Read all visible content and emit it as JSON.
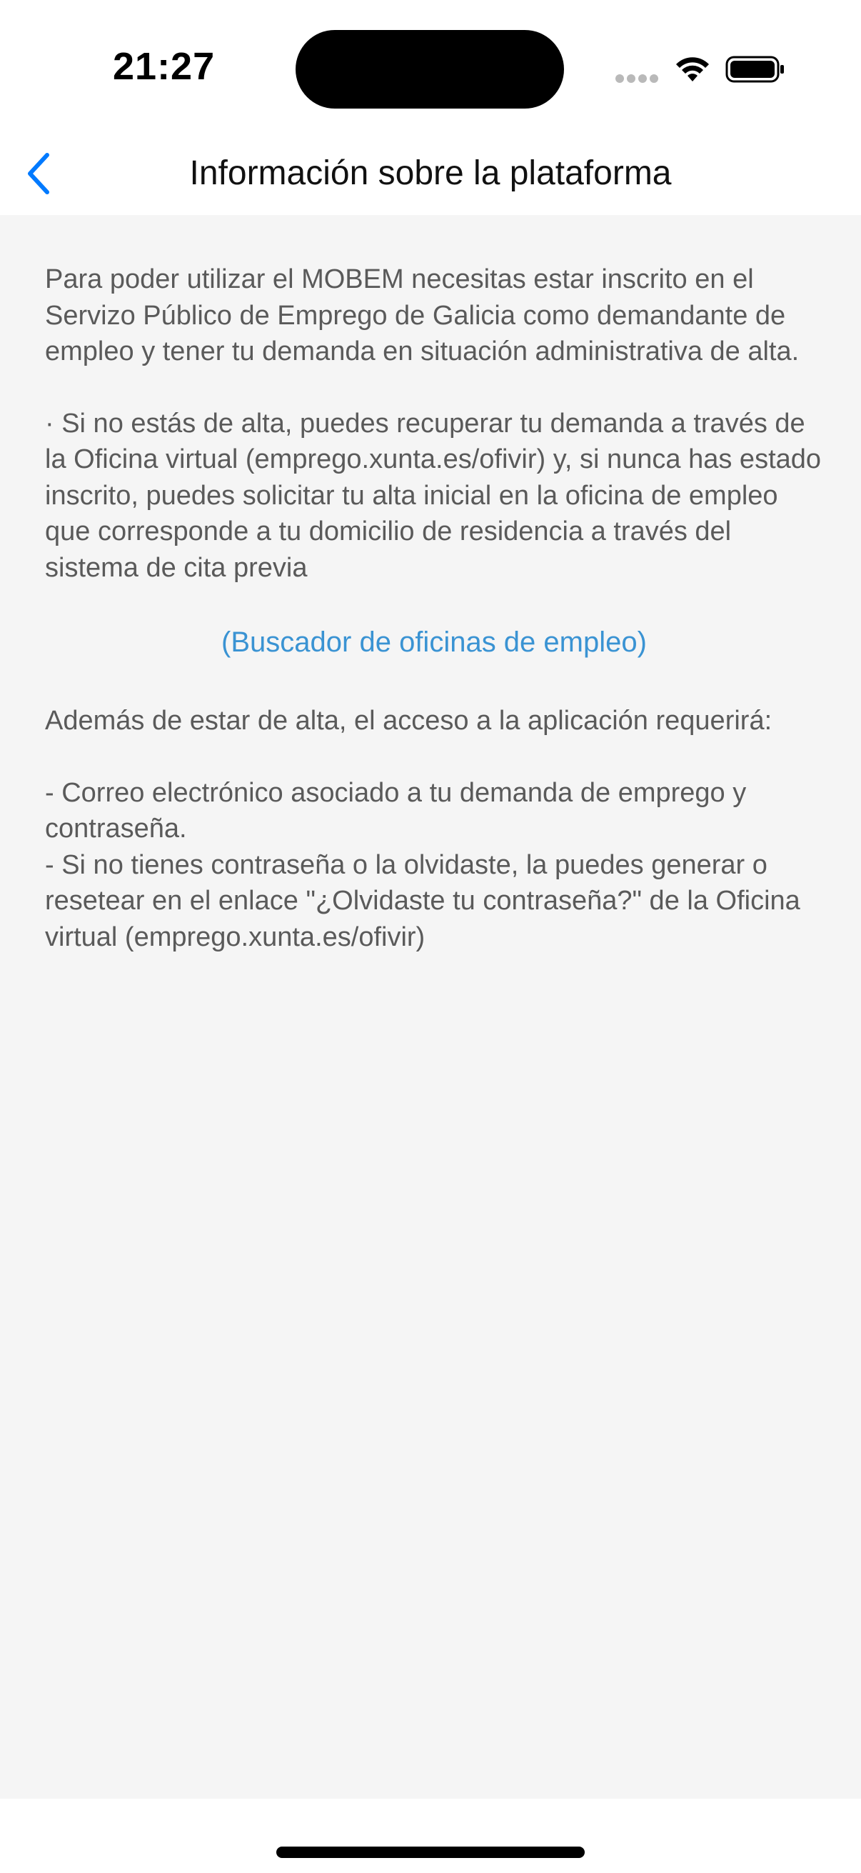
{
  "status_bar": {
    "time": "21:27"
  },
  "nav": {
    "title": "Información sobre la plataforma",
    "back_icon": "chevron-left-icon"
  },
  "content": {
    "intro": "Para poder utilizar el MOBEM necesitas estar inscrito en el Servizo Público de Emprego de Galicia como demandante de empleo y tener tu demanda en situación administrativa de alta.",
    "bullet": "· Si no estás de alta, puedes recuperar tu demanda a través de la Oficina virtual (emprego.xunta.es/ofivir) y, si nunca has estado inscrito, puedes solicitar tu alta inicial en la oficina de empleo que corresponde a tu domicilio de residencia a través del sistema de cita previa",
    "link": "(Buscador de oficinas de empleo)",
    "requirements_intro": "Además de estar de alta, el acceso a la aplicación requerirá:",
    "requirement_1": "- Correo electrónico asociado a tu demanda de emprego y contraseña.",
    "requirement_2": "- Si no tienes contraseña o la olvidaste, la puedes generar o resetear en el enlace \"¿Olvidaste tu contraseña?\" de la Oficina virtual (emprego.xunta.es/ofivir)"
  },
  "colors": {
    "accent": "#007aff",
    "link": "#3a93d3",
    "body_text": "#5a5a5a",
    "background": "#f5f5f5"
  }
}
